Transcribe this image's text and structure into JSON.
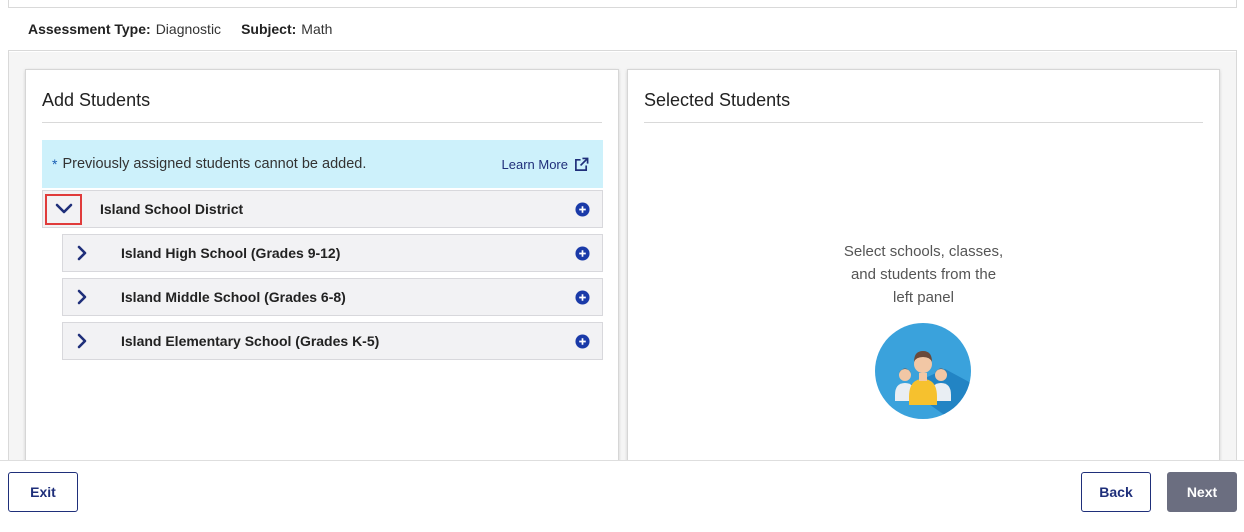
{
  "header": {
    "assessment_type_label": "Assessment Type:",
    "assessment_type_value": "Diagnostic",
    "subject_label": "Subject:",
    "subject_value": "Math"
  },
  "add_panel": {
    "title": "Add Students",
    "notice_text": "Previously assigned students cannot be added.",
    "notice_asterisk": "*",
    "learn_more": "Learn More",
    "district": {
      "label": "Island School District",
      "expanded": true
    },
    "schools": [
      {
        "label": "Island High School (Grades 9-12)"
      },
      {
        "label": "Island Middle School (Grades 6-8)"
      },
      {
        "label": "Island Elementary School (Grades K-5)"
      }
    ]
  },
  "selected_panel": {
    "title": "Selected Students",
    "empty_line1": "Select schools, classes,",
    "empty_line2": "and students from the",
    "empty_line3": "left panel"
  },
  "footer": {
    "exit_label": "Exit",
    "back_label": "Back",
    "next_label": "Next"
  },
  "colors": {
    "accent_navy": "#1f2f7a",
    "notice_bg": "#cdf1fb",
    "next_bg": "#6b6e80",
    "highlight_red": "#e03b3b",
    "add_icon": "#1a3aa8"
  }
}
